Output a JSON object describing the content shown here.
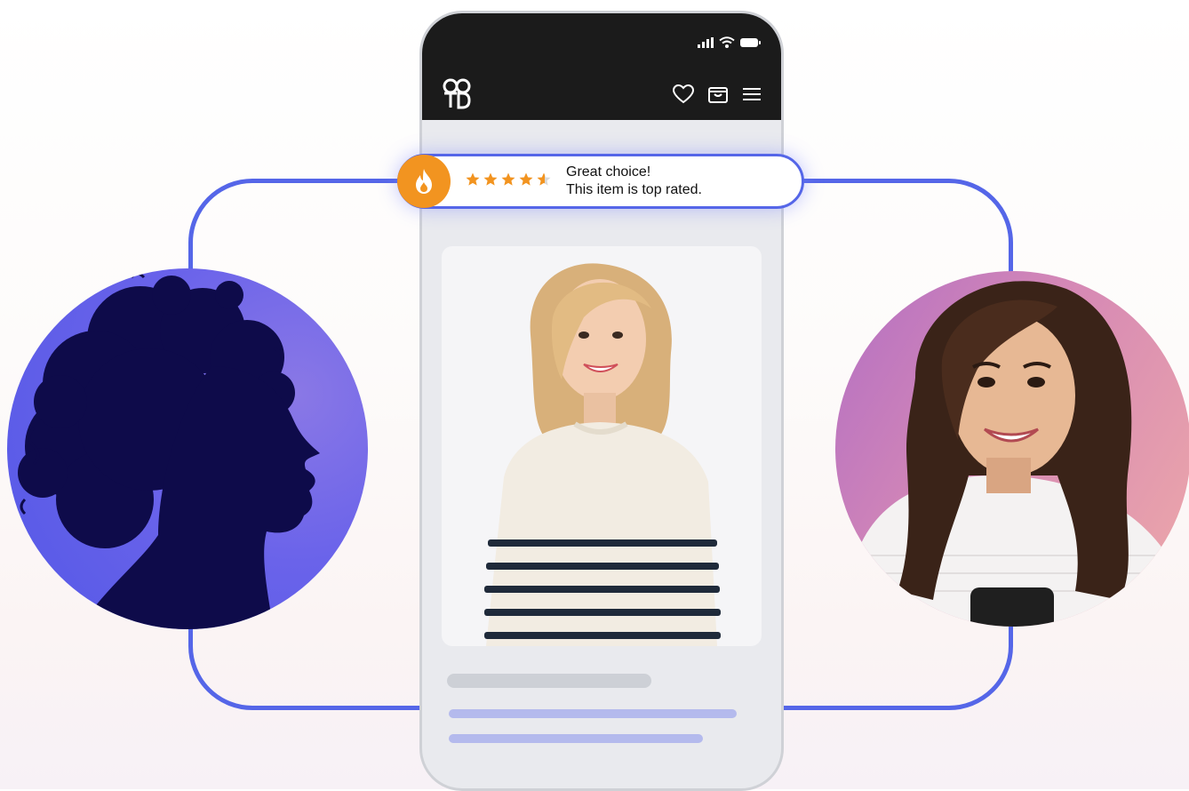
{
  "rating": {
    "stars": 4.5,
    "line1": "Great choice!",
    "line2": "This item is top rated."
  },
  "colors": {
    "accent": "#5566e8",
    "badge": "#f29420",
    "star": "#f29420",
    "header": "#1b1b1b"
  },
  "icons": {
    "logo": "brand-logo",
    "signal": "signal-icon",
    "wifi": "wifi-icon",
    "battery": "battery-icon",
    "wishlist": "heart-icon",
    "cart": "shopping-bag-icon",
    "menu": "hamburger-menu-icon",
    "badge": "flame-icon"
  }
}
